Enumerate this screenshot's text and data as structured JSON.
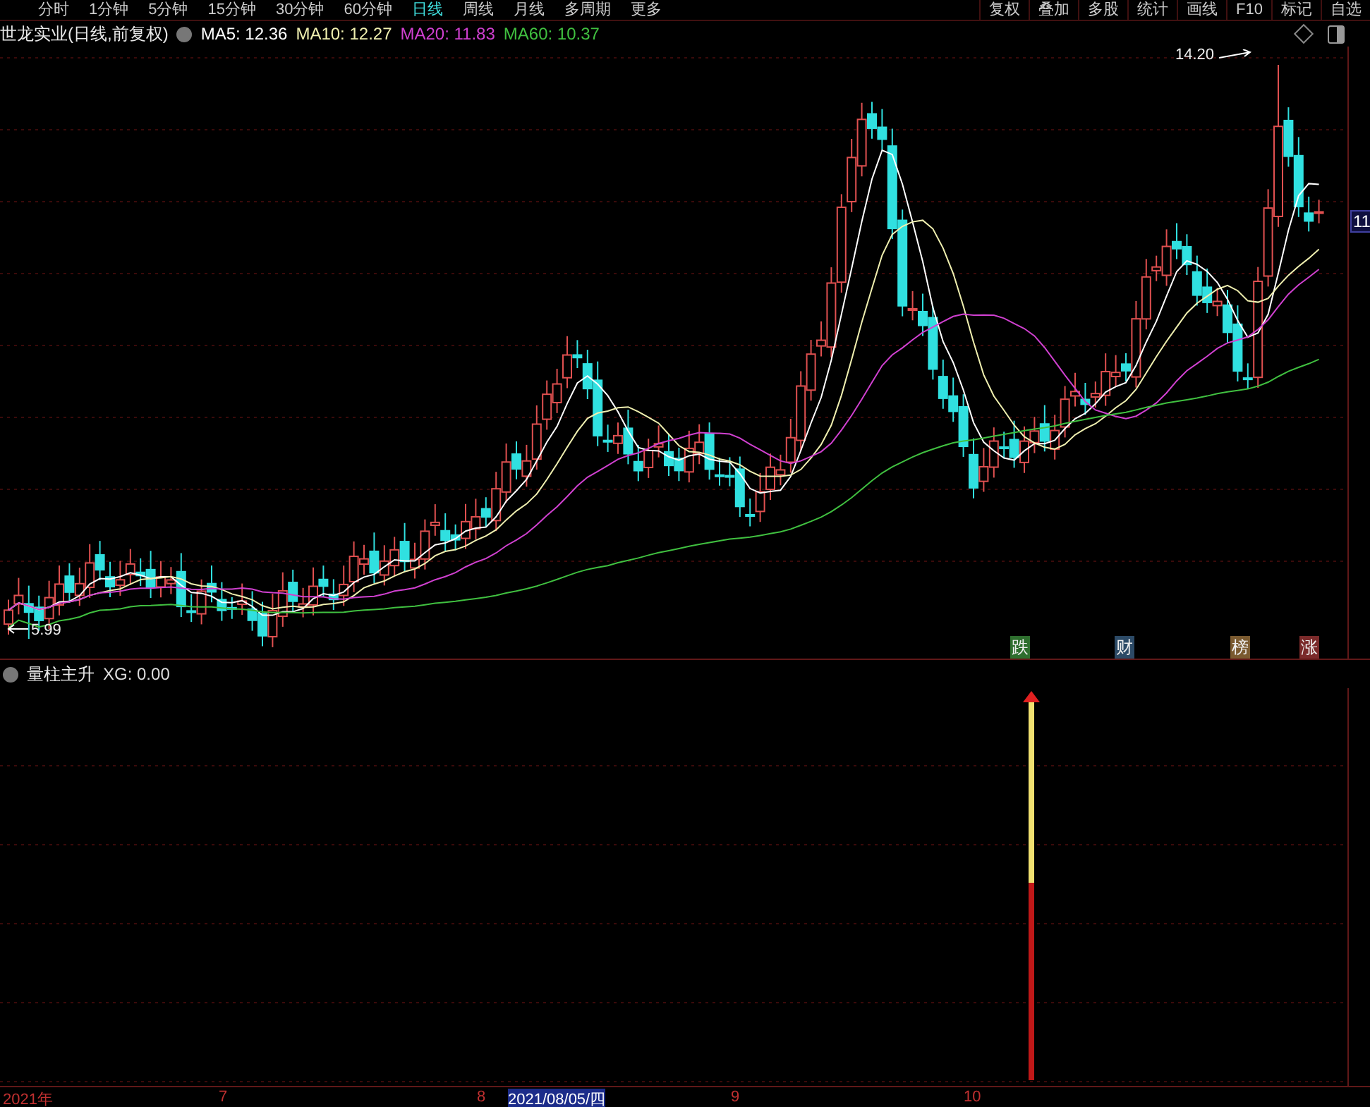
{
  "toolbar": {
    "periods": [
      {
        "label": "分时",
        "selected": false
      },
      {
        "label": "1分钟",
        "selected": false
      },
      {
        "label": "5分钟",
        "selected": false
      },
      {
        "label": "15分钟",
        "selected": false
      },
      {
        "label": "30分钟",
        "selected": false
      },
      {
        "label": "60分钟",
        "selected": false
      },
      {
        "label": "日线",
        "selected": true
      },
      {
        "label": "周线",
        "selected": false
      },
      {
        "label": "月线",
        "selected": false
      },
      {
        "label": "多周期",
        "selected": false
      },
      {
        "label": "更多",
        "selected": false
      }
    ],
    "tools": [
      "复权",
      "叠加",
      "多股",
      "统计",
      "画线",
      "F10",
      "标记",
      "自选"
    ]
  },
  "chart": {
    "title": "世龙实业(日线,前复权)",
    "indicators": [
      {
        "label": "MA5: 12.36",
        "color": "#ffffff"
      },
      {
        "label": "MA10: 12.27",
        "color": "#f0f0b0"
      },
      {
        "label": "MA20: 11.83",
        "color": "#d040d0"
      },
      {
        "label": "MA60: 10.37",
        "color": "#40c040"
      }
    ],
    "high_label": "14.20",
    "low_label": "5.99",
    "price_tag": "11",
    "events": [
      {
        "label": "跌",
        "color": "#2e6e2e"
      },
      {
        "label": "财",
        "color": "#2c4a66"
      },
      {
        "label": "榜",
        "color": "#7a5a30"
      },
      {
        "label": "涨",
        "color": "#7a2a2a"
      }
    ]
  },
  "indicator_panel": {
    "title": "量柱主升",
    "readings": [
      "XG: 0.00"
    ]
  },
  "time_axis": [
    {
      "label": "2021年",
      "selected": false
    },
    {
      "label": "7",
      "selected": false
    },
    {
      "label": "8",
      "selected": false
    },
    {
      "label": "2021/08/05/四",
      "selected": true
    },
    {
      "label": "9",
      "selected": false
    },
    {
      "label": "10",
      "selected": false
    }
  ]
}
